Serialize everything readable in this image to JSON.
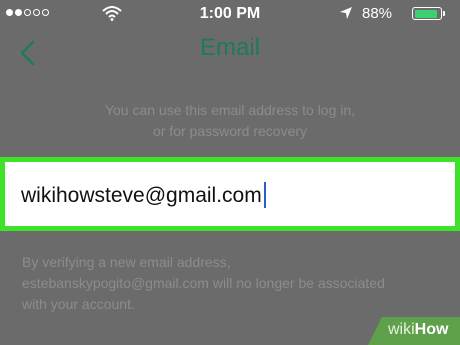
{
  "status_bar": {
    "time": "1:00 PM",
    "battery_percent": "88%",
    "battery_level": 0.88,
    "signal_strength": 2,
    "signal_total": 5
  },
  "nav": {
    "title": "Email",
    "back_icon": "chevron-left-icon"
  },
  "hint": {
    "line1": "You can use this email address to log in,",
    "line2": "or for password recovery"
  },
  "email_field": {
    "value": "wikihowsteve@gmail.com"
  },
  "warning": {
    "line1": "By verifying a new email address,",
    "line2": "estebanskypogito@gmail.com will no longer be associated",
    "line3": "with your account."
  },
  "watermark": {
    "part1": "wiki",
    "part2": "How"
  },
  "colors": {
    "accent": "#1e7a5c",
    "highlight": "#3ee22a",
    "overlay": "#6b6b6b"
  }
}
